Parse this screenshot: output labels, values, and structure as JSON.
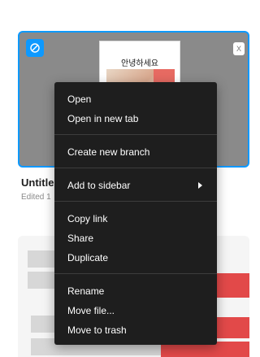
{
  "file1": {
    "title": "Untitled",
    "edited": "Edited 1",
    "thumbnail_text": "안녕하세요",
    "badge_icon": "figma-logo-icon",
    "right_button_glyph": "X"
  },
  "context_menu": {
    "groups": [
      [
        "Open",
        "Open in new tab"
      ],
      [
        "Create new branch"
      ],
      [
        "Add to sidebar"
      ],
      [
        "Copy link",
        "Share",
        "Duplicate"
      ],
      [
        "Rename",
        "Move file...",
        "Move to trash"
      ]
    ],
    "submenu_icon": "chevron-right-icon"
  },
  "colors": {
    "accent": "#0d99ff",
    "menu_background": "#1e1e1e",
    "thumbnail_red": "#e24949"
  }
}
